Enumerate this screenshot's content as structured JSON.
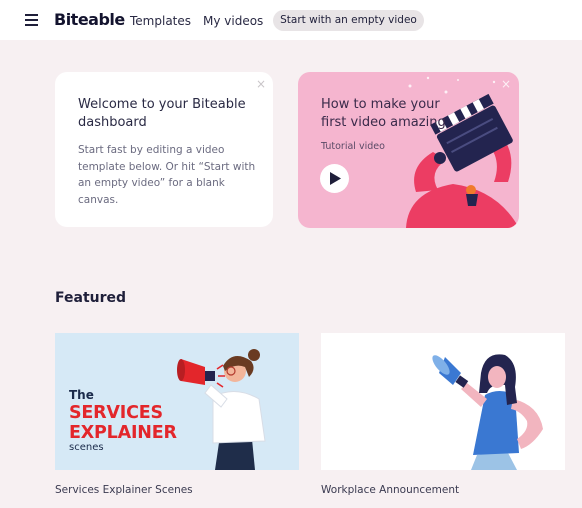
{
  "header": {
    "logo": "Biteable",
    "nav": {
      "templates": "Templates",
      "my_videos": "My videos"
    },
    "start_empty_label": "Start with an empty video"
  },
  "welcome_card": {
    "title": "Welcome to your Biteable dashboard",
    "body": "Start fast by editing a video template below. Or hit “Start with an empty video” for a blank canvas.",
    "close": "×"
  },
  "tutorial_card": {
    "title": "How to make your first video amazing",
    "subtitle": "Tutorial video",
    "close": "×"
  },
  "featured": {
    "heading": "Featured",
    "items": [
      {
        "title": "Services Explainer Scenes",
        "thumb_text": {
          "line1": "The",
          "line2": "SERVICES",
          "line3": "EXPLAINER",
          "line4": "scenes"
        }
      },
      {
        "title": "Workplace Announcement"
      }
    ]
  },
  "colors": {
    "page_bg": "#f7f0f2",
    "tutorial_bg": "#f5b5cf",
    "accent_red": "#e3262b",
    "thumb1_bg": "#d6e9f6"
  },
  "icons": [
    "menu-icon",
    "close-icon",
    "play-icon",
    "megaphone-icon"
  ]
}
